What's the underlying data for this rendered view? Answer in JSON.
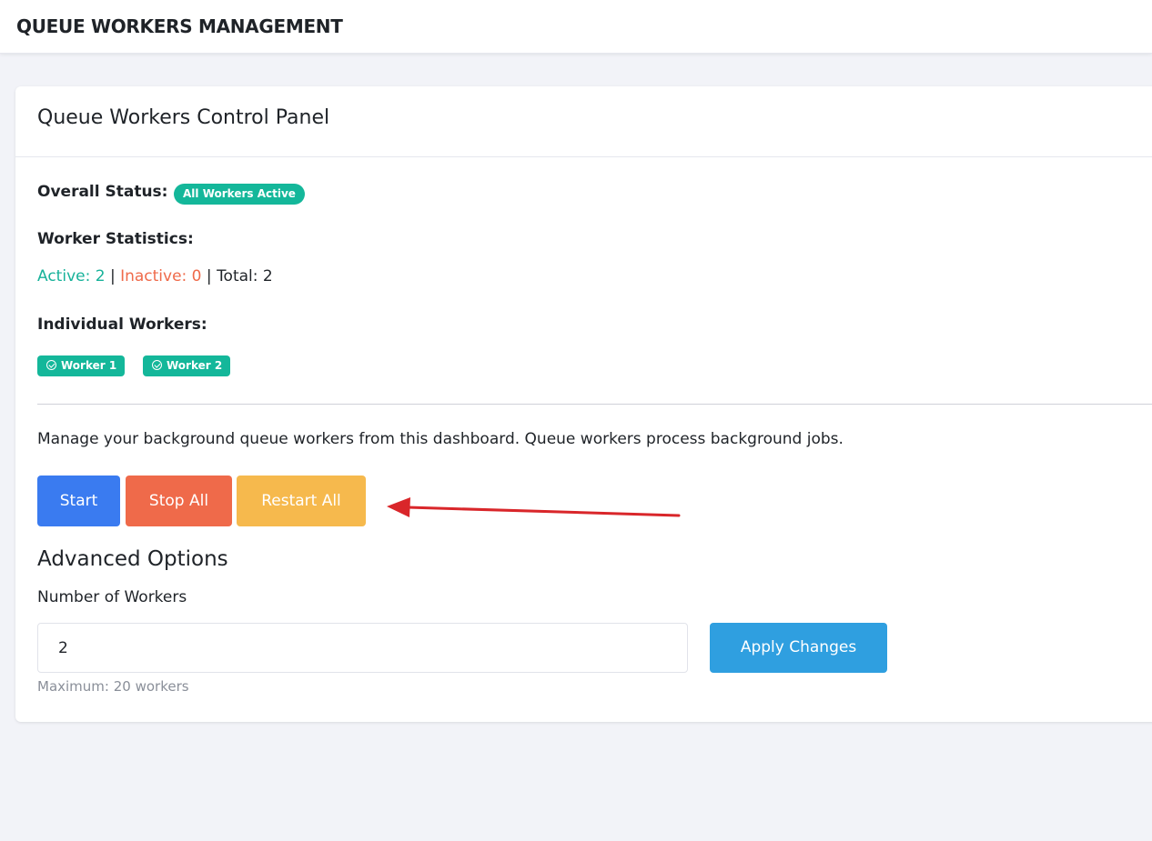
{
  "header": {
    "title": "QUEUE WORKERS MANAGEMENT"
  },
  "panel": {
    "title": "Queue Workers Control Panel",
    "overall_status_label": "Overall Status:",
    "overall_status_badge": "All Workers Active",
    "statistics_label": "Worker Statistics:",
    "stats": {
      "active": "Active: 2",
      "separator": "|",
      "inactive": "Inactive: 0",
      "total": "Total: 2"
    },
    "individual_workers_label": "Individual Workers:",
    "workers": [
      {
        "label": "Worker 1",
        "icon": "check-circle-icon"
      },
      {
        "label": "Worker 2",
        "icon": "check-circle-icon"
      }
    ],
    "description": "Manage your background queue workers from this dashboard. Queue workers process background jobs.",
    "buttons": {
      "start": "Start",
      "stop_all": "Stop All",
      "restart_all": "Restart All"
    },
    "advanced": {
      "title": "Advanced Options",
      "workers_field_label": "Number of Workers",
      "workers_value": "2",
      "apply_label": "Apply Changes",
      "help_text": "Maximum: 20 workers"
    }
  },
  "colors": {
    "success": "#14b79a",
    "danger": "#ef6a4a",
    "warning": "#f6b94d",
    "primary": "#3a7bf0",
    "info": "#2f9fe0",
    "annotation_arrow": "#d9262a"
  }
}
